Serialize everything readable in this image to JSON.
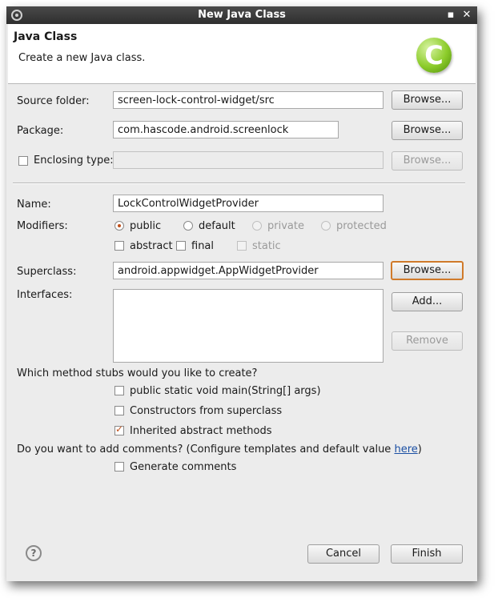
{
  "window": {
    "title": "New Java Class",
    "minimize_glyph": "▪",
    "close_glyph": "✕"
  },
  "header": {
    "title": "Java Class",
    "description": "Create a new Java class.",
    "logo_letter": "C"
  },
  "source_folder": {
    "label": "Source folder:",
    "value": "screen-lock-control-widget/src",
    "browse_label": "Browse..."
  },
  "package": {
    "label": "Package:",
    "value": "com.hascode.android.screenlock",
    "browse_label": "Browse..."
  },
  "enclosing": {
    "label": "Enclosing type:",
    "value": "",
    "browse_label": "Browse..."
  },
  "name": {
    "label": "Name:",
    "value": "LockControlWidgetProvider"
  },
  "modifiers": {
    "label": "Modifiers:",
    "radios": [
      "public",
      "default",
      "private",
      "protected"
    ],
    "checks": [
      "abstract",
      "final",
      "static"
    ]
  },
  "superclass": {
    "label": "Superclass:",
    "value": "android.appwidget.AppWidgetProvider",
    "browse_label": "Browse..."
  },
  "interfaces": {
    "label": "Interfaces:",
    "add_label": "Add...",
    "remove_label": "Remove"
  },
  "stubs": {
    "question": "Which method stubs would you like to create?",
    "options": [
      "public static void main(String[] args)",
      "Constructors from superclass",
      "Inherited abstract methods"
    ]
  },
  "comments": {
    "question": "Do you want to add comments? (Configure templates and default value ",
    "link": "here",
    "closing": ")",
    "option": "Generate comments"
  },
  "footer": {
    "help_glyph": "?",
    "cancel_label": "Cancel",
    "finish_label": "Finish"
  }
}
